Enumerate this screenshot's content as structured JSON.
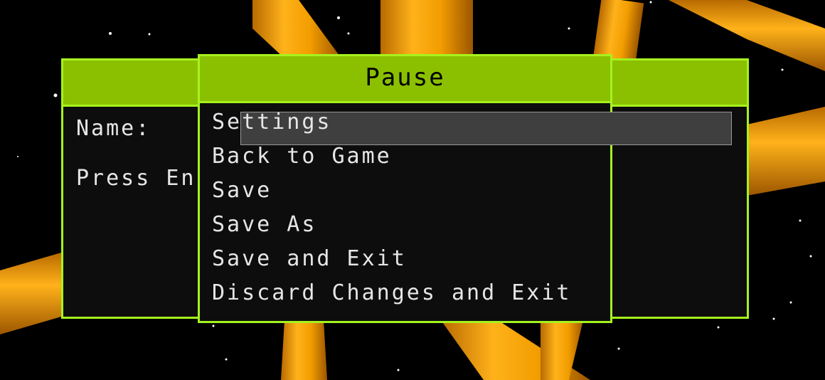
{
  "background": {
    "sky_color": "#000000",
    "tube_color": "#f0a500"
  },
  "name_dialog": {
    "name_label": "Name:",
    "press_enter_text": "Press En"
  },
  "pause_menu": {
    "title": "Pause",
    "selected_index": 0,
    "items": [
      "Settings",
      "Back to Game",
      "Save",
      "Save As",
      "Save and Exit",
      "Discard Changes and Exit"
    ]
  },
  "colors": {
    "accent": "#8bc000",
    "border": "#a6f21d",
    "panel_bg": "#0d0d0d",
    "text": "#e6e6e6",
    "highlight_bg": "#3f3f3f"
  }
}
